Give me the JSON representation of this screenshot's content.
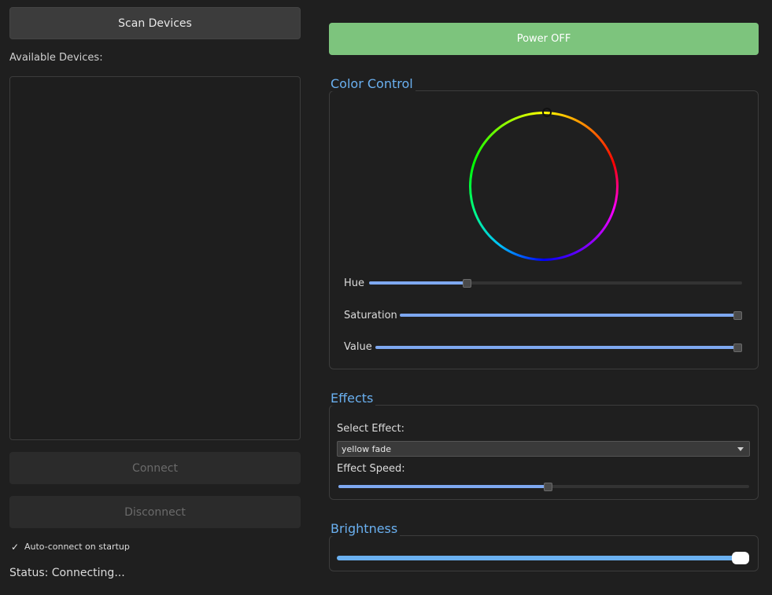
{
  "left": {
    "scan_label": "Scan Devices",
    "available_label": "Available Devices:",
    "devices": [],
    "connect_label": "Connect",
    "disconnect_label": "Disconnect",
    "autoconnect": {
      "label": "Auto-connect on startup",
      "checked": true,
      "check_glyph": "✓"
    },
    "status_text": "Status: Connecting..."
  },
  "power": {
    "label": "Power OFF",
    "color": "#7dc47d"
  },
  "color_control": {
    "title": "Color Control",
    "hue": {
      "label": "Hue",
      "value": 0.25
    },
    "saturation": {
      "label": "Saturation",
      "value": 1.0
    },
    "value": {
      "label": "Value",
      "value": 1.0
    }
  },
  "effects": {
    "title": "Effects",
    "select_label": "Select Effect:",
    "selected_effect": "yellow fade",
    "speed_label": "Effect Speed:",
    "speed_value": 0.5
  },
  "brightness": {
    "title": "Brightness",
    "value": 1.0
  },
  "colors": {
    "accent": "#6ab0f0",
    "slider_fill": "#7ea8f0",
    "power_button": "#7dc47d"
  }
}
